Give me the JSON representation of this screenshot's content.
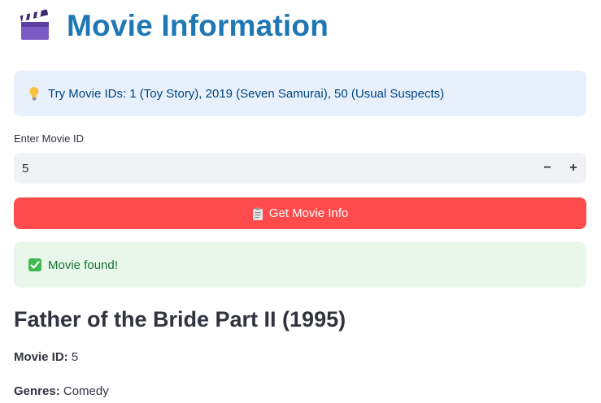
{
  "header": {
    "title": "Movie Information",
    "icon": "clapperboard-icon"
  },
  "info": {
    "icon": "lightbulb-icon",
    "text": "Try Movie IDs: 1 (Toy Story), 2019 (Seven Samurai), 50 (Usual Suspects)"
  },
  "movie_id_input": {
    "label": "Enter Movie ID",
    "value": "5",
    "decrement_label": "−",
    "increment_label": "+"
  },
  "submit": {
    "icon": "clipboard-icon",
    "label": "Get Movie Info"
  },
  "status": {
    "icon": "check-mark-icon",
    "text": "Movie found!"
  },
  "movie": {
    "title": "Father of the Bride Part II (1995)",
    "id_label": "Movie ID:",
    "id_value": "5",
    "genres_label": "Genres:",
    "genres_value": "Comedy"
  },
  "colors": {
    "title": "#1f77b4",
    "info_bg": "#e8f1fb",
    "info_text": "#004280",
    "button_bg": "#ff4b4b",
    "success_bg": "#e8f7ea",
    "success_text": "#177233"
  }
}
